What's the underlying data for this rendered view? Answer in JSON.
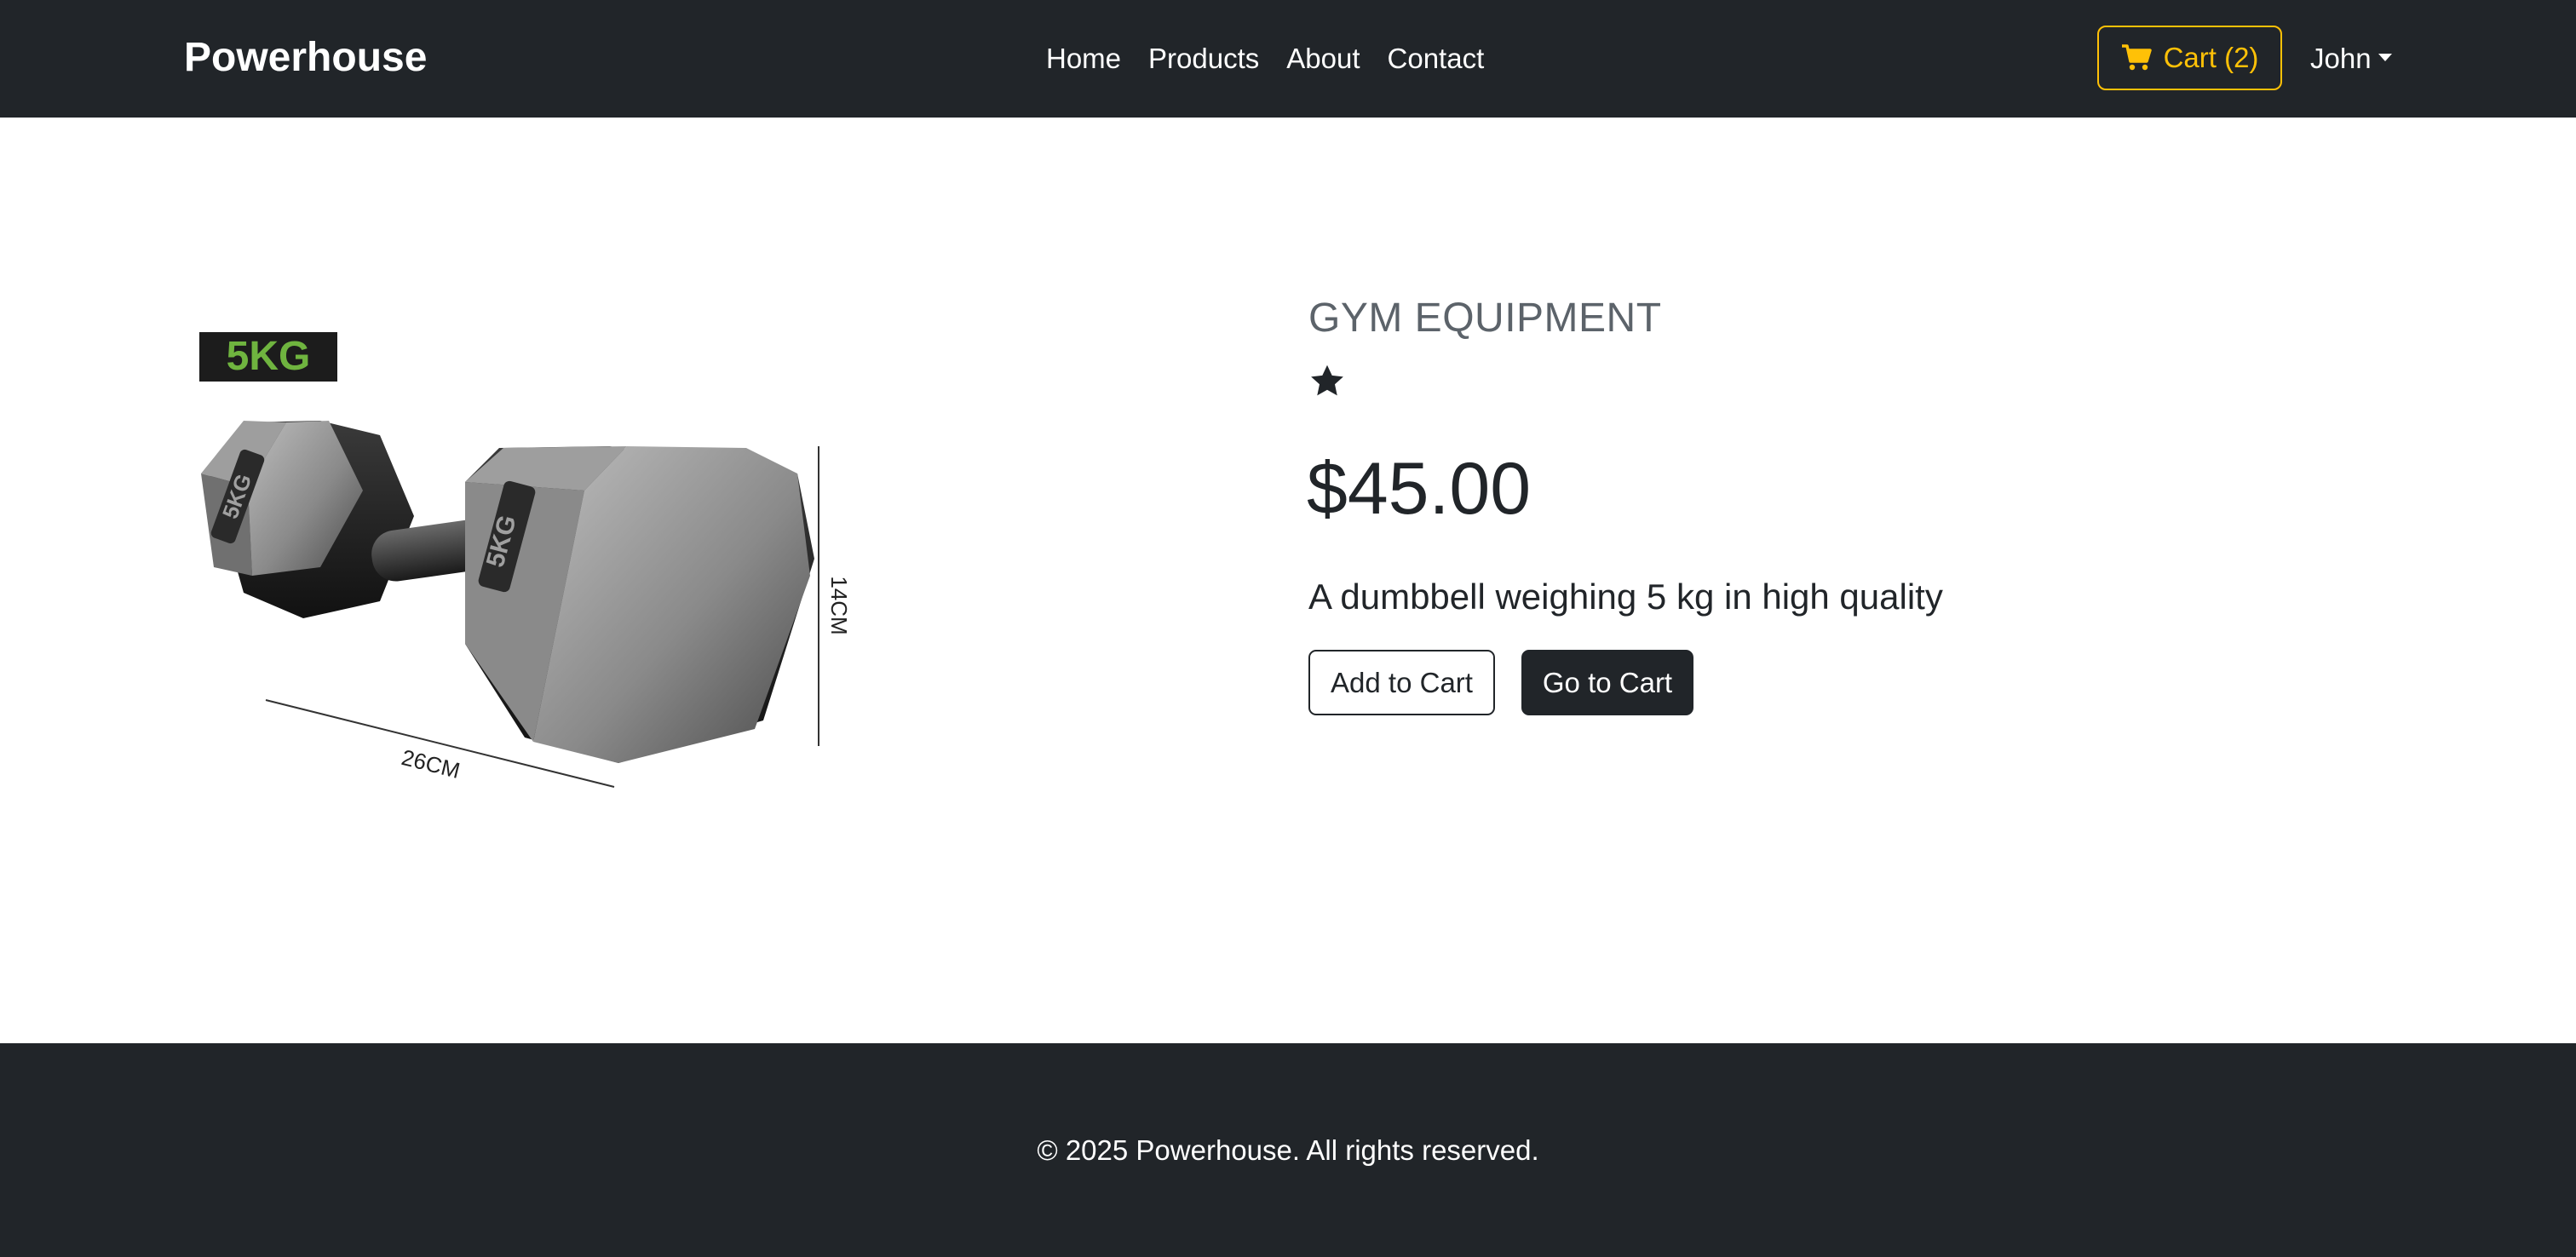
{
  "navbar": {
    "brand": "Powerhouse",
    "links": [
      "Home",
      "Products",
      "About",
      "Contact"
    ],
    "cart_label": "Cart (2)",
    "user_name": "John"
  },
  "product": {
    "image_badge": "5KG",
    "image_labels": {
      "plate_text": "5KG",
      "width": "26CM",
      "height": "14CM"
    },
    "category": "GYM EQUIPMENT",
    "rating_stars": 1,
    "price": "$45.00",
    "description": "A dumbbell weighing 5 kg in high quality",
    "add_to_cart_label": "Add to Cart",
    "go_to_cart_label": "Go to Cart"
  },
  "footer": {
    "text": "© 2025 Powerhouse. All rights reserved."
  },
  "colors": {
    "dark": "#212529",
    "accent": "#ffc107",
    "badge_green": "#6fb43f",
    "muted": "#5c636a"
  },
  "icons": {
    "cart": "shopping-cart-icon",
    "star": "star-icon",
    "caret": "caret-down-icon"
  }
}
